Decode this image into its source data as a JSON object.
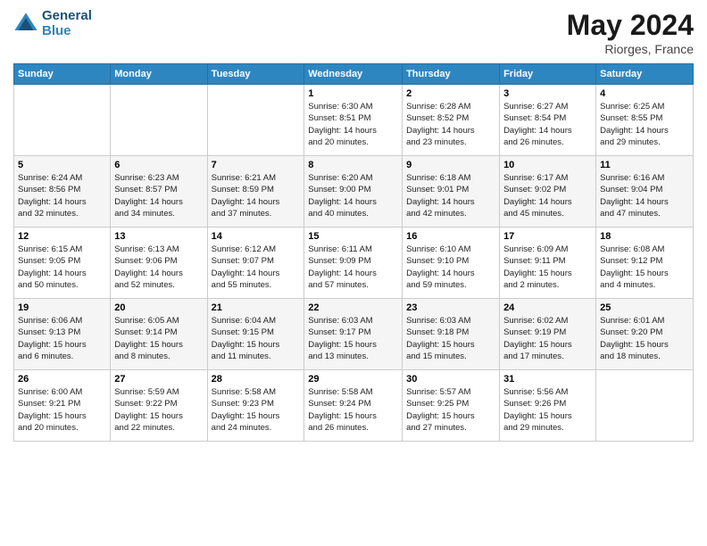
{
  "header": {
    "logo_line1": "General",
    "logo_line2": "Blue",
    "month": "May 2024",
    "location": "Riorges, France"
  },
  "weekdays": [
    "Sunday",
    "Monday",
    "Tuesday",
    "Wednesday",
    "Thursday",
    "Friday",
    "Saturday"
  ],
  "weeks": [
    [
      {
        "day": "",
        "info": ""
      },
      {
        "day": "",
        "info": ""
      },
      {
        "day": "",
        "info": ""
      },
      {
        "day": "1",
        "info": "Sunrise: 6:30 AM\nSunset: 8:51 PM\nDaylight: 14 hours\nand 20 minutes."
      },
      {
        "day": "2",
        "info": "Sunrise: 6:28 AM\nSunset: 8:52 PM\nDaylight: 14 hours\nand 23 minutes."
      },
      {
        "day": "3",
        "info": "Sunrise: 6:27 AM\nSunset: 8:54 PM\nDaylight: 14 hours\nand 26 minutes."
      },
      {
        "day": "4",
        "info": "Sunrise: 6:25 AM\nSunset: 8:55 PM\nDaylight: 14 hours\nand 29 minutes."
      }
    ],
    [
      {
        "day": "5",
        "info": "Sunrise: 6:24 AM\nSunset: 8:56 PM\nDaylight: 14 hours\nand 32 minutes."
      },
      {
        "day": "6",
        "info": "Sunrise: 6:23 AM\nSunset: 8:57 PM\nDaylight: 14 hours\nand 34 minutes."
      },
      {
        "day": "7",
        "info": "Sunrise: 6:21 AM\nSunset: 8:59 PM\nDaylight: 14 hours\nand 37 minutes."
      },
      {
        "day": "8",
        "info": "Sunrise: 6:20 AM\nSunset: 9:00 PM\nDaylight: 14 hours\nand 40 minutes."
      },
      {
        "day": "9",
        "info": "Sunrise: 6:18 AM\nSunset: 9:01 PM\nDaylight: 14 hours\nand 42 minutes."
      },
      {
        "day": "10",
        "info": "Sunrise: 6:17 AM\nSunset: 9:02 PM\nDaylight: 14 hours\nand 45 minutes."
      },
      {
        "day": "11",
        "info": "Sunrise: 6:16 AM\nSunset: 9:04 PM\nDaylight: 14 hours\nand 47 minutes."
      }
    ],
    [
      {
        "day": "12",
        "info": "Sunrise: 6:15 AM\nSunset: 9:05 PM\nDaylight: 14 hours\nand 50 minutes."
      },
      {
        "day": "13",
        "info": "Sunrise: 6:13 AM\nSunset: 9:06 PM\nDaylight: 14 hours\nand 52 minutes."
      },
      {
        "day": "14",
        "info": "Sunrise: 6:12 AM\nSunset: 9:07 PM\nDaylight: 14 hours\nand 55 minutes."
      },
      {
        "day": "15",
        "info": "Sunrise: 6:11 AM\nSunset: 9:09 PM\nDaylight: 14 hours\nand 57 minutes."
      },
      {
        "day": "16",
        "info": "Sunrise: 6:10 AM\nSunset: 9:10 PM\nDaylight: 14 hours\nand 59 minutes."
      },
      {
        "day": "17",
        "info": "Sunrise: 6:09 AM\nSunset: 9:11 PM\nDaylight: 15 hours\nand 2 minutes."
      },
      {
        "day": "18",
        "info": "Sunrise: 6:08 AM\nSunset: 9:12 PM\nDaylight: 15 hours\nand 4 minutes."
      }
    ],
    [
      {
        "day": "19",
        "info": "Sunrise: 6:06 AM\nSunset: 9:13 PM\nDaylight: 15 hours\nand 6 minutes."
      },
      {
        "day": "20",
        "info": "Sunrise: 6:05 AM\nSunset: 9:14 PM\nDaylight: 15 hours\nand 8 minutes."
      },
      {
        "day": "21",
        "info": "Sunrise: 6:04 AM\nSunset: 9:15 PM\nDaylight: 15 hours\nand 11 minutes."
      },
      {
        "day": "22",
        "info": "Sunrise: 6:03 AM\nSunset: 9:17 PM\nDaylight: 15 hours\nand 13 minutes."
      },
      {
        "day": "23",
        "info": "Sunrise: 6:03 AM\nSunset: 9:18 PM\nDaylight: 15 hours\nand 15 minutes."
      },
      {
        "day": "24",
        "info": "Sunrise: 6:02 AM\nSunset: 9:19 PM\nDaylight: 15 hours\nand 17 minutes."
      },
      {
        "day": "25",
        "info": "Sunrise: 6:01 AM\nSunset: 9:20 PM\nDaylight: 15 hours\nand 18 minutes."
      }
    ],
    [
      {
        "day": "26",
        "info": "Sunrise: 6:00 AM\nSunset: 9:21 PM\nDaylight: 15 hours\nand 20 minutes."
      },
      {
        "day": "27",
        "info": "Sunrise: 5:59 AM\nSunset: 9:22 PM\nDaylight: 15 hours\nand 22 minutes."
      },
      {
        "day": "28",
        "info": "Sunrise: 5:58 AM\nSunset: 9:23 PM\nDaylight: 15 hours\nand 24 minutes."
      },
      {
        "day": "29",
        "info": "Sunrise: 5:58 AM\nSunset: 9:24 PM\nDaylight: 15 hours\nand 26 minutes."
      },
      {
        "day": "30",
        "info": "Sunrise: 5:57 AM\nSunset: 9:25 PM\nDaylight: 15 hours\nand 27 minutes."
      },
      {
        "day": "31",
        "info": "Sunrise: 5:56 AM\nSunset: 9:26 PM\nDaylight: 15 hours\nand 29 minutes."
      },
      {
        "day": "",
        "info": ""
      }
    ]
  ]
}
